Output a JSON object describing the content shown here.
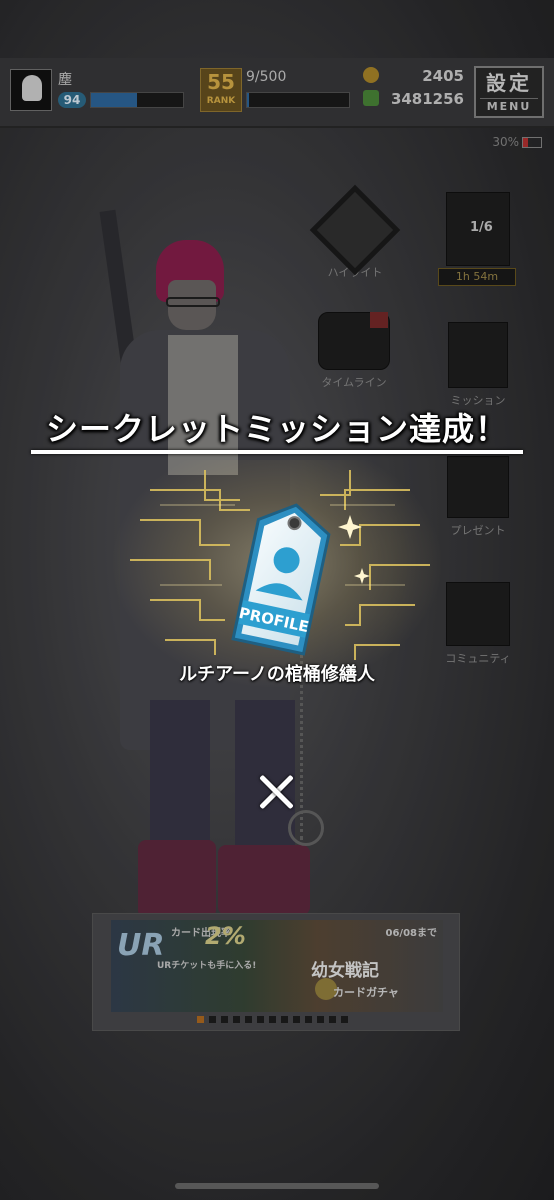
{
  "status_bar": {
    "player_name": "塵",
    "player_level": "94",
    "player_exp_fraction": 0.5,
    "rank_value": "55",
    "rank_label": "RANK",
    "stamina": "9/500",
    "stamina_fraction": 0.02,
    "coins": "2405",
    "money": "3481256",
    "menu_kanji": "設定",
    "menu_latin": "MENU",
    "battery": "30%"
  },
  "side_menu": {
    "highlight_label": "ハイライト",
    "timeline_label": "タイムライン",
    "mission_label": "ミッション",
    "present_label": "プレゼント",
    "community_label": "コミュニティ",
    "page_counter": "1/6",
    "timer": "1h 54m"
  },
  "banner": {
    "ur_text": "UR",
    "rate_text": "カード出現率",
    "rate_pct": "2%",
    "ticket_text": "URチケットも手に入る!",
    "date_text": "06/08まで",
    "title": "幼女戦記",
    "subtitle": "カードガチャ",
    "dots_total": 13,
    "dots_active_index": 0
  },
  "modal": {
    "title": "シークレットミッション達成！",
    "badge_text": "PROFILE",
    "reward_name": "ルチアーノの棺桶修繕人",
    "close_icon": "close-icon"
  },
  "colors": {
    "accent_blue": "#2f9fd0",
    "gold": "#e0c66a",
    "exp_bar": "#2f6aa0"
  }
}
